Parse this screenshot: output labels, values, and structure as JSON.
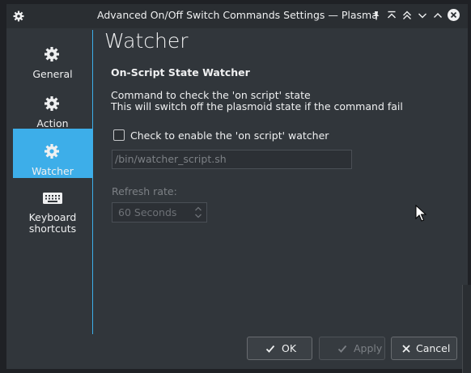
{
  "window": {
    "title": "Advanced On/Off Switch Commands Settings — Plasma"
  },
  "sidebar": {
    "items": [
      {
        "label": "General",
        "icon": "gear-icon",
        "active": false
      },
      {
        "label": "Action",
        "icon": "gear-icon",
        "active": false
      },
      {
        "label": "Watcher",
        "icon": "gear-icon",
        "active": true
      },
      {
        "label_line1": "Keyboard",
        "label_line2": "shortcuts",
        "icon": "keyboard-icon",
        "active": false
      }
    ]
  },
  "page": {
    "title": "Watcher",
    "section_title": "On-Script State Watcher",
    "desc_line1": "Command to check the 'on script' state",
    "desc_line2": "This will switch off the plasmoid state if the command fail",
    "checkbox_label": "Check to enable the 'on script' watcher",
    "checkbox_checked": false,
    "command_value": "/bin/watcher_script.sh",
    "refresh_label": "Refresh rate:",
    "refresh_value": "60 Seconds"
  },
  "buttons": {
    "ok": "OK",
    "apply": "Apply",
    "cancel": "Cancel"
  },
  "colors": {
    "accent": "#3daee9",
    "window_bg": "#31363b",
    "titlebar_bg": "#2a2e32",
    "text": "#eff0f1",
    "disabled_text": "#7c8085"
  }
}
